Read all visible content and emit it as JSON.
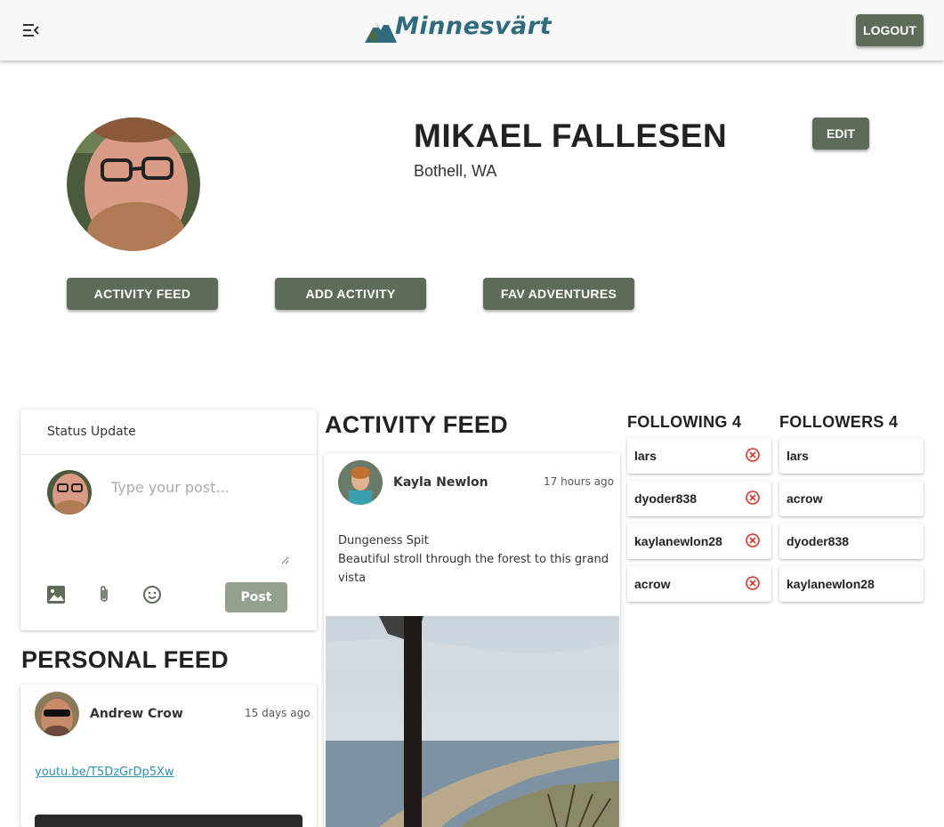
{
  "app": {
    "logo_text": "Minnesvärt",
    "logout_label": "LOGOUT",
    "menu_icon": "menu-collapse-icon",
    "logo_icon": "mountain-logo-icon"
  },
  "profile": {
    "name": "MIKAEL FALLESEN",
    "location": "Bothell, WA",
    "edit_label": "EDIT"
  },
  "nav": {
    "activity_feed": "ACTIVITY FEED",
    "add_activity": "ADD ACTIVITY",
    "fav_adventures": "FAV ADVENTURES"
  },
  "status": {
    "header": "Status Update",
    "placeholder": "Type your post...",
    "post_label": "Post",
    "icons": [
      "image-icon",
      "paperclip-icon",
      "emoji-icon"
    ]
  },
  "personal_feed": {
    "title": "PERSONAL FEED",
    "posts": [
      {
        "author": "Andrew Crow",
        "time": "15 days ago",
        "link": "youtu.be/T5DzGrDp5Xw"
      }
    ]
  },
  "activity_feed": {
    "title": "ACTIVITY FEED",
    "posts": [
      {
        "author": "Kayla Newlon",
        "time": "17 hours ago",
        "title": "Dungeness Spit",
        "body_line1": "Beautiful stroll through the forest to this grand",
        "body_line2": "vista"
      }
    ]
  },
  "following": {
    "title": "FOLLOWING 4",
    "users": [
      "lars",
      "dyoder838",
      "kaylanewlon28",
      "acrow"
    ],
    "remove_icon": "remove-circle-icon"
  },
  "followers": {
    "title": "FOLLOWERS 4",
    "users": [
      "lars",
      "acrow",
      "dyoder838",
      "kaylanewlon28"
    ]
  },
  "colors": {
    "button_bg": "#5e6b59",
    "post_button_bg": "#92a08d",
    "logo_teal": "#2f6b7d",
    "link": "#2c8fb0",
    "remove_red": "#d0342c"
  }
}
